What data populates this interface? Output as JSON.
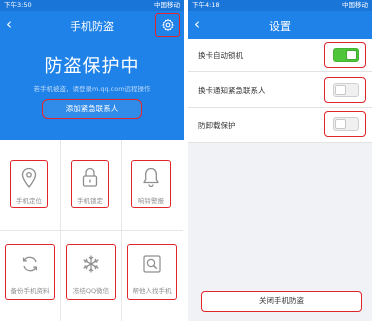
{
  "left": {
    "status": {
      "time": "下午3:50",
      "right": "中国移动"
    },
    "title": "手机防盗",
    "hero": {
      "title": "防盗保护中",
      "subtitle": "若手机被盗，请登录m.qq.com远程操作",
      "button": "添加紧急联系人"
    },
    "tiles": [
      {
        "label": "手机定位",
        "icon": "location-pin-icon"
      },
      {
        "label": "手机锁定",
        "icon": "lock-icon"
      },
      {
        "label": "响铃警报",
        "icon": "bell-icon"
      },
      {
        "label": "备份手机资料",
        "icon": "refresh-icon"
      },
      {
        "label": "冻结QQ微信",
        "icon": "snowflake-icon"
      },
      {
        "label": "帮他人找手机",
        "icon": "search-icon"
      }
    ]
  },
  "right": {
    "status": {
      "time": "下午4:18",
      "right": "中国移动"
    },
    "title": "设置",
    "settings": [
      {
        "label": "换卡自动锁机",
        "enabled": true
      },
      {
        "label": "换卡通知紧急联系人",
        "enabled": false
      },
      {
        "label": "防卸载保护",
        "enabled": false
      }
    ],
    "close_button": "关闭手机防盗"
  },
  "colors": {
    "primary": "#1f82e8",
    "highlight": "#e0262b",
    "toggle_on": "#4fc53b"
  }
}
